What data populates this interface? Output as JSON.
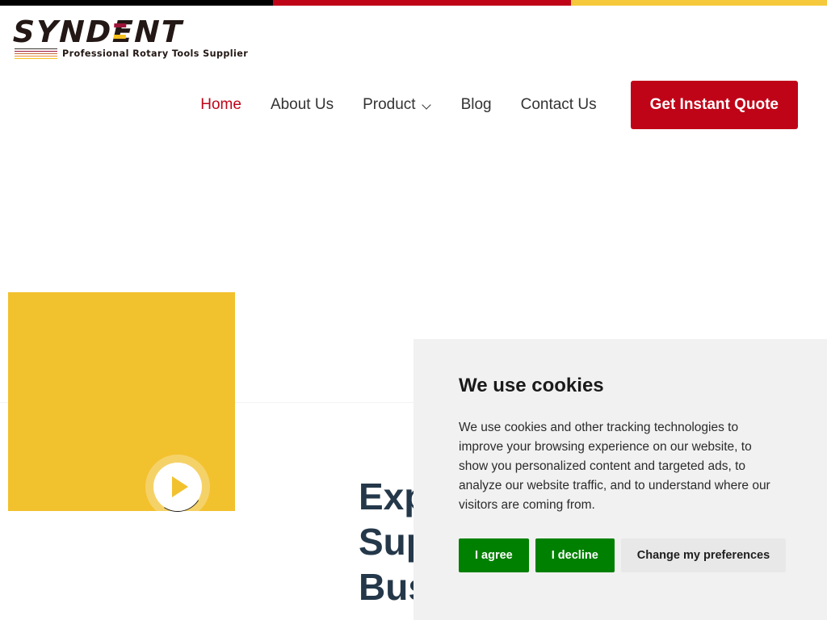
{
  "topbar": {
    "segments": [
      {
        "name": "black",
        "color": "#000000"
      },
      {
        "name": "red",
        "color": "#C00418"
      },
      {
        "name": "yellow",
        "color": "#F5C93B"
      }
    ]
  },
  "logo": {
    "word_part1": "SYND",
    "word_part_e": "E",
    "word_part2": "NT",
    "tagline": "Professional Rotary Tools Supplier",
    "accent_red": "#9E1438",
    "accent_yellow": "#F5C01F",
    "text_color": "#231815"
  },
  "nav": {
    "items": [
      {
        "label": "Home",
        "active": true
      },
      {
        "label": "About Us",
        "active": false
      },
      {
        "label": "Product",
        "active": false,
        "has_dropdown": true
      },
      {
        "label": "Blog",
        "active": false
      },
      {
        "label": "Contact Us",
        "active": false
      }
    ],
    "cta_label": "Get Instant Quote",
    "active_color": "#C00418",
    "cta_bg": "#C00418"
  },
  "hero": {
    "heading_line1": "Exp",
    "heading_line2": "Sup",
    "heading_line3": "Bus",
    "heading_color": "#24384A",
    "video_bg": "#F2C12E",
    "play_icon": "play-triangle-icon"
  },
  "cookie": {
    "title": "We use cookies",
    "body": "We use cookies and other tracking technologies to improve your browsing experience on our website, to show you personalized content and targeted ads, to analyze our website traffic, and to understand where our visitors are coming from.",
    "agree_label": "I agree",
    "decline_label": "I decline",
    "preferences_label": "Change my preferences",
    "agree_color": "#008000",
    "panel_bg": "#F1F1F1"
  }
}
